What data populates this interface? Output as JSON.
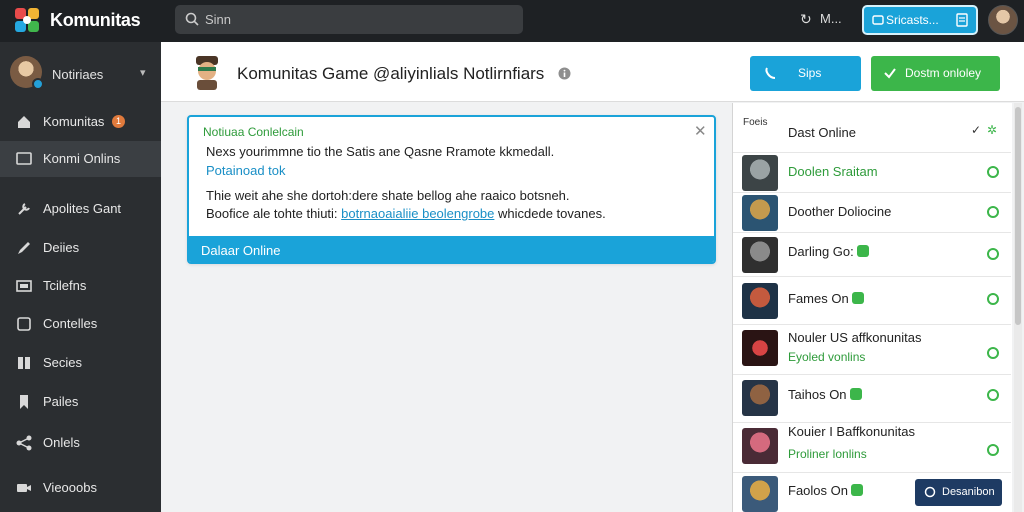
{
  "topbar": {
    "brand": "Komunitas",
    "search_placeholder": "Sinn",
    "refresh_icon": "refresh-icon",
    "user_label": "M...",
    "cta_label": "Sricasts...",
    "colors": {
      "bar": "#1e2124",
      "accent": "#1aa3d9"
    }
  },
  "sidebar": {
    "profile_label": "Notiriaes",
    "items": [
      {
        "label": "Komunitas",
        "icon": "home-icon",
        "badge": "1"
      },
      {
        "label": "Konmi Onlins",
        "icon": "monitor-icon"
      },
      {
        "label": "Apolites Gant",
        "icon": "wrench-icon"
      },
      {
        "label": "Deiies",
        "icon": "pen-icon"
      },
      {
        "label": "Tcilefns",
        "icon": "window-icon"
      },
      {
        "label": "Contelles",
        "icon": "square-icon"
      },
      {
        "label": "Secies",
        "icon": "book-icon"
      },
      {
        "label": "Pailes",
        "icon": "bookmark-icon"
      },
      {
        "label": "Onlels",
        "icon": "share-icon"
      },
      {
        "label": "Vieooobs",
        "icon": "video-icon"
      }
    ]
  },
  "header": {
    "title": "Komunitas Game @aliyinlials Notlirnfiars",
    "btn_blue": "Sips",
    "btn_green": "Dostm onloley"
  },
  "notification": {
    "title": "Notiuaa Conlelcain",
    "line1": "Nexs yourimmne tio the Satis ane Qasne Rramote kkmedall.",
    "link1": "Potainoad tok",
    "line2": "Thie weit ahe she dortoh:dere shate bellog ahe raaico botsneh.",
    "line3_pre": "Boofice ale tohte thiuti:",
    "line3_link": "botrnaoaialiie beolengrobe",
    "line3_post": "whicdede tovanes.",
    "footer": "Dalaar Online"
  },
  "friends": {
    "heading": "Foeis",
    "first": "Dast Online",
    "rows": [
      {
        "name": "Doolen Sraitam",
        "green": true
      },
      {
        "name": "Doother Doliocine",
        "green_suffix": "Doliocine"
      },
      {
        "name": "Darling Go:",
        "badge": true
      },
      {
        "name": "Fames On",
        "badge": true
      },
      {
        "name": "Nouler US affkonunitas",
        "sub": "Eyoled vonlins"
      },
      {
        "name": "Taihos On",
        "badge": true
      },
      {
        "name": "Kouier I Baffkonunitas",
        "sub": "Proliner lonlins"
      },
      {
        "name": "Faolos On",
        "badge": true
      }
    ],
    "chat_btn": "Desanibon"
  }
}
